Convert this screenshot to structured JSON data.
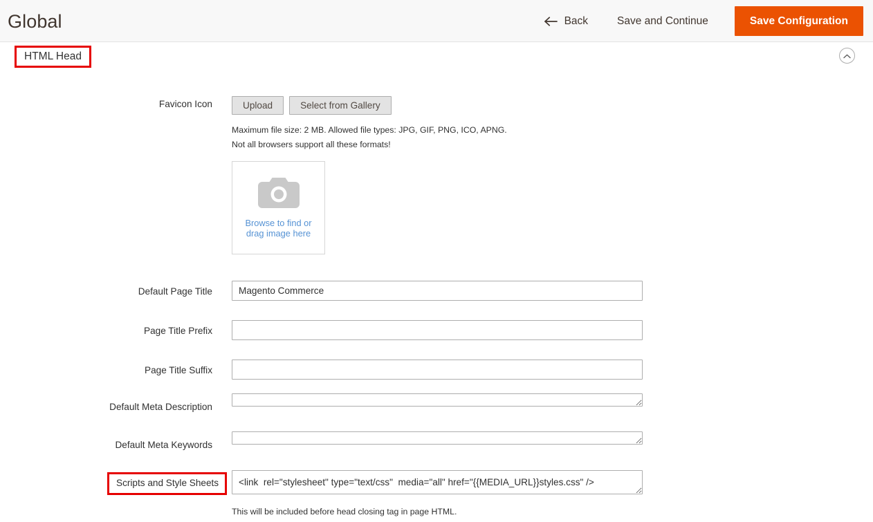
{
  "header": {
    "title": "Global",
    "back_label": "Back",
    "back_icon": "arrow-left-icon",
    "save_continue_label": "Save and Continue",
    "save_config_label": "Save Configuration",
    "accent_color": "#eb5202"
  },
  "section": {
    "title": "HTML Head",
    "collapse_icon": "chevron-up-circle-icon",
    "highlight_color": "#e60000"
  },
  "fields": {
    "favicon": {
      "label": "Favicon Icon",
      "upload_label": "Upload",
      "gallery_label": "Select from Gallery",
      "note_line1": "Maximum file size: 2 MB. Allowed file types: JPG, GIF, PNG, ICO, APNG.",
      "note_line2": "Not all browsers support all these formats!",
      "dropzone_icon": "camera-icon",
      "dropzone_line1": "Browse to find or",
      "dropzone_line2": "drag image here"
    },
    "default_page_title": {
      "label": "Default Page Title",
      "value": "Magento Commerce",
      "placeholder": ""
    },
    "page_title_prefix": {
      "label": "Page Title Prefix",
      "value": "",
      "placeholder": ""
    },
    "page_title_suffix": {
      "label": "Page Title Suffix",
      "value": "",
      "placeholder": ""
    },
    "default_meta_description": {
      "label": "Default Meta Description",
      "value": "",
      "placeholder": ""
    },
    "default_meta_keywords": {
      "label": "Default Meta Keywords",
      "value": "",
      "placeholder": ""
    },
    "scripts_and_style_sheets": {
      "label": "Scripts and Style Sheets",
      "value": "<link  rel=\"stylesheet\" type=\"text/css\"  media=\"all\" href=\"{{MEDIA_URL}}styles.css\" />",
      "placeholder": "",
      "help": "This will be included before head closing tag in page HTML."
    }
  }
}
